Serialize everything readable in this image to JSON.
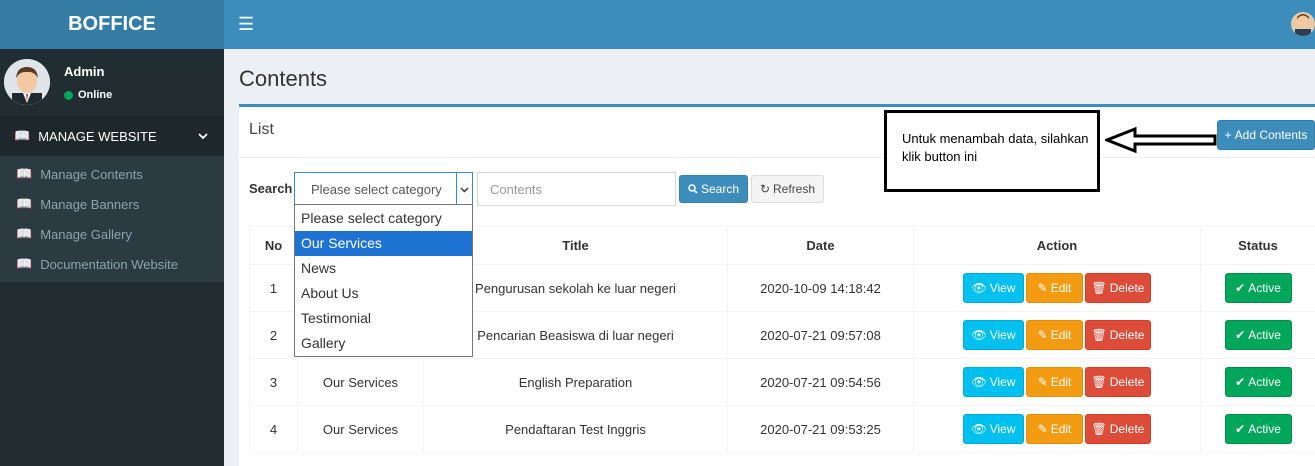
{
  "app": {
    "logo": "BOFFICE"
  },
  "navbar": {
    "menu_icon": "hamburger-icon",
    "avatar_icon": "user-avatar-icon"
  },
  "sidebar": {
    "user": {
      "name": "Admin",
      "status": "Online",
      "status_color": "#00a65a"
    },
    "menu_header": "MANAGE WEBSITE",
    "items": [
      {
        "label": "Manage Contents"
      },
      {
        "label": "Manage Banners"
      },
      {
        "label": "Manage Gallery"
      },
      {
        "label": "Documentation Website"
      }
    ]
  },
  "page": {
    "title": "Contents"
  },
  "box": {
    "title": "List",
    "add_button": "Add Contents"
  },
  "search": {
    "label": "Search",
    "select_value": "Please select category",
    "input_placeholder": "Contents",
    "search_button": "Search",
    "refresh_button": "Refresh"
  },
  "dropdown": {
    "options": [
      "Please select category",
      "Our Services",
      "News",
      "About Us",
      "Testimonial",
      "Gallery"
    ],
    "highlighted": "Our Services"
  },
  "table": {
    "headers": [
      "No",
      "",
      "Title",
      "Date",
      "Action",
      "Status"
    ],
    "rows": [
      {
        "no": "1",
        "category": "",
        "title": "Pengurusan sekolah ke luar negeri",
        "date": "2020-10-09 14:18:42"
      },
      {
        "no": "2",
        "category": "",
        "title": "Pencarian Beasiswa di luar negeri",
        "date": "2020-07-21 09:57:08"
      },
      {
        "no": "3",
        "category": "Our Services",
        "title": "English Preparation",
        "date": "2020-07-21 09:54:56"
      },
      {
        "no": "4",
        "category": "Our Services",
        "title": "Pendaftaran Test Inggris",
        "date": "2020-07-21 09:53:25"
      }
    ],
    "action_labels": {
      "view": "View",
      "edit": "Edit",
      "delete": "Delete"
    },
    "status_label": "Active"
  },
  "annotation": {
    "text": "Untuk menambah data, silahkan klik button ini"
  }
}
